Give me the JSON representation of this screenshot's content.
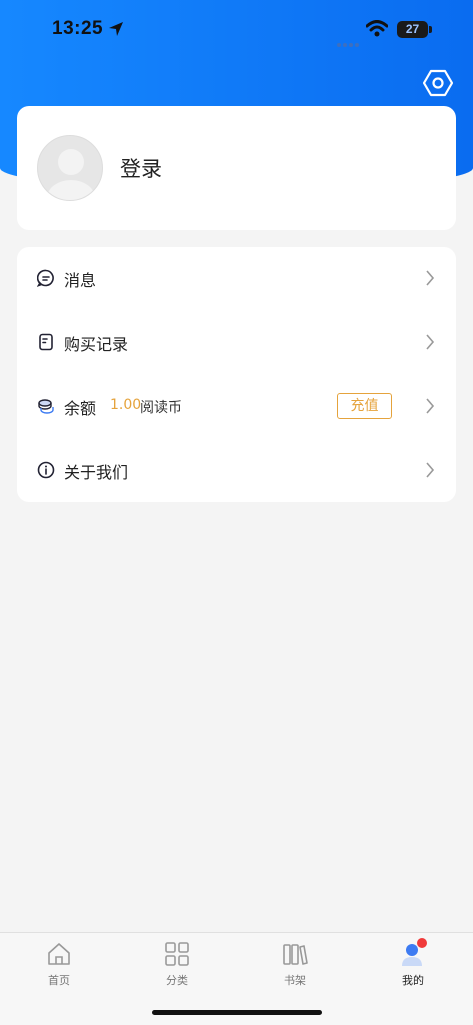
{
  "status_bar": {
    "time": "13:25",
    "battery": "27"
  },
  "header": {
    "settings_icon": "hexagon-settings-icon"
  },
  "profile": {
    "login_label": "登录",
    "avatar_icon": "default-avatar"
  },
  "menu": {
    "items": [
      {
        "label": "消息",
        "icon": "message-icon"
      },
      {
        "label": "购买记录",
        "icon": "receipt-icon"
      },
      {
        "label": "余额",
        "icon": "coins-icon",
        "amount": "1.00",
        "unit": "阅读币",
        "action": "充值"
      },
      {
        "label": "关于我们",
        "icon": "info-icon"
      }
    ]
  },
  "tabs": [
    {
      "label": "首页",
      "icon": "home-icon",
      "active": false
    },
    {
      "label": "分类",
      "icon": "grid-icon",
      "active": false
    },
    {
      "label": "书架",
      "icon": "bookshelf-icon",
      "active": false
    },
    {
      "label": "我的",
      "icon": "profile-icon",
      "active": true
    }
  ],
  "colors": {
    "header_blue": "#1688ff",
    "accent_orange": "#e5a33c",
    "active_tab_blue": "#3d7bf2",
    "notify_red": "#f03a3a"
  }
}
